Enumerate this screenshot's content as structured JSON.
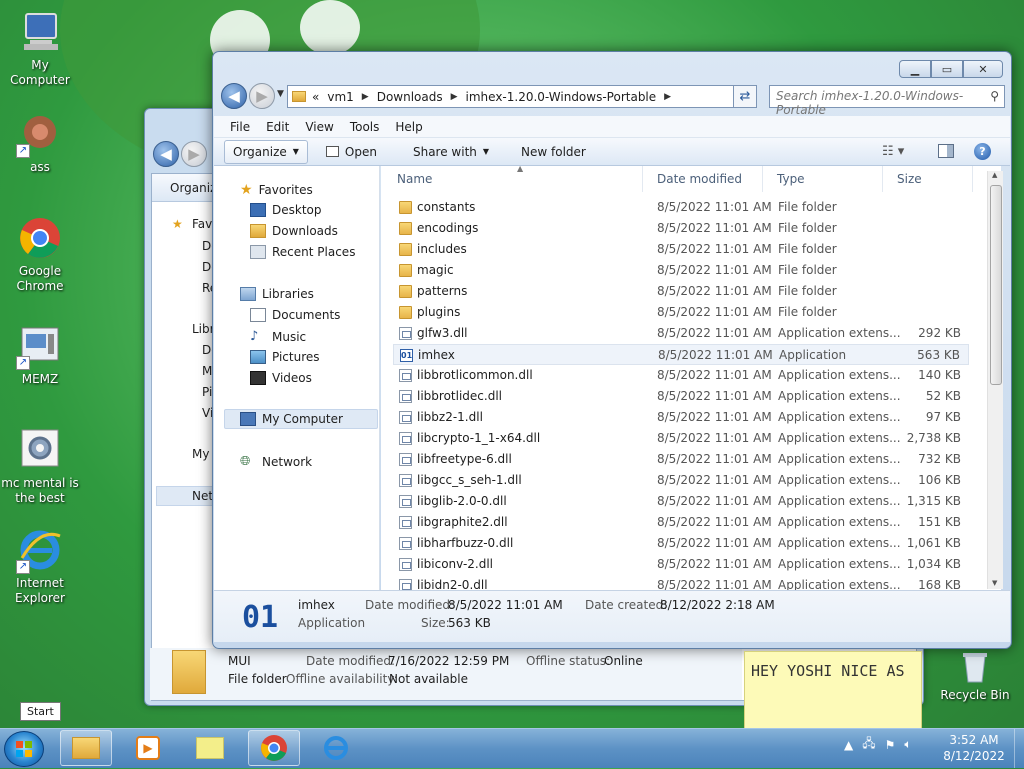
{
  "desktop": {
    "icons": [
      {
        "label": "My Computer"
      },
      {
        "label": "ass"
      },
      {
        "label": "Google Chrome"
      },
      {
        "label": "MEMZ"
      },
      {
        "label": "mc mental is the best"
      },
      {
        "label": "Internet Explorer"
      },
      {
        "label": "Recycle Bin"
      }
    ]
  },
  "back_window": {
    "toolbar_label": "Organize",
    "nav": [
      "Favo",
      "De",
      "Do",
      "Re",
      "Libr",
      "Do",
      "M",
      "Pi",
      "Vi",
      "My",
      "Net"
    ],
    "details": {
      "name": "MUI",
      "type": "File folder",
      "date_modified_label": "Date modified:",
      "date_modified": "7/16/2022 12:59 PM",
      "offline_status_label": "Offline status:",
      "offline_status": "Online",
      "offline_avail_label": "Offline availability:",
      "offline_avail": "Not available"
    }
  },
  "window": {
    "address": {
      "prefix": "«",
      "crumbs": [
        "vm1",
        "Downloads",
        "imhex-1.20.0-Windows-Portable"
      ]
    },
    "search_placeholder": "Search imhex-1.20.0-Windows-Portable",
    "menu": [
      "File",
      "Edit",
      "View",
      "Tools",
      "Help"
    ],
    "toolbar": {
      "organize": "Organize",
      "open": "Open",
      "share_with": "Share with",
      "new_folder": "New folder"
    },
    "nav": {
      "favorites": "Favorites",
      "desktop": "Desktop",
      "downloads": "Downloads",
      "recent": "Recent Places",
      "libraries": "Libraries",
      "documents": "Documents",
      "music": "Music",
      "pictures": "Pictures",
      "videos": "Videos",
      "computer": "My Computer",
      "network": "Network"
    },
    "columns": {
      "name": "Name",
      "date": "Date modified",
      "type": "Type",
      "size": "Size"
    },
    "files": [
      {
        "name": "constants",
        "date": "8/5/2022 11:01 AM",
        "type": "File folder",
        "size": "",
        "kind": "folder"
      },
      {
        "name": "encodings",
        "date": "8/5/2022 11:01 AM",
        "type": "File folder",
        "size": "",
        "kind": "folder"
      },
      {
        "name": "includes",
        "date": "8/5/2022 11:01 AM",
        "type": "File folder",
        "size": "",
        "kind": "folder"
      },
      {
        "name": "magic",
        "date": "8/5/2022 11:01 AM",
        "type": "File folder",
        "size": "",
        "kind": "folder"
      },
      {
        "name": "patterns",
        "date": "8/5/2022 11:01 AM",
        "type": "File folder",
        "size": "",
        "kind": "folder"
      },
      {
        "name": "plugins",
        "date": "8/5/2022 11:01 AM",
        "type": "File folder",
        "size": "",
        "kind": "folder"
      },
      {
        "name": "glfw3.dll",
        "date": "8/5/2022 11:01 AM",
        "type": "Application extens...",
        "size": "292 KB",
        "kind": "dll"
      },
      {
        "name": "imhex",
        "date": "8/5/2022 11:01 AM",
        "type": "Application",
        "size": "563 KB",
        "kind": "app"
      },
      {
        "name": "libbrotlicommon.dll",
        "date": "8/5/2022 11:01 AM",
        "type": "Application extens...",
        "size": "140 KB",
        "kind": "dll"
      },
      {
        "name": "libbrotlidec.dll",
        "date": "8/5/2022 11:01 AM",
        "type": "Application extens...",
        "size": "52 KB",
        "kind": "dll"
      },
      {
        "name": "libbz2-1.dll",
        "date": "8/5/2022 11:01 AM",
        "type": "Application extens...",
        "size": "97 KB",
        "kind": "dll"
      },
      {
        "name": "libcrypto-1_1-x64.dll",
        "date": "8/5/2022 11:01 AM",
        "type": "Application extens...",
        "size": "2,738 KB",
        "kind": "dll"
      },
      {
        "name": "libfreetype-6.dll",
        "date": "8/5/2022 11:01 AM",
        "type": "Application extens...",
        "size": "732 KB",
        "kind": "dll"
      },
      {
        "name": "libgcc_s_seh-1.dll",
        "date": "8/5/2022 11:01 AM",
        "type": "Application extens...",
        "size": "106 KB",
        "kind": "dll"
      },
      {
        "name": "libglib-2.0-0.dll",
        "date": "8/5/2022 11:01 AM",
        "type": "Application extens...",
        "size": "1,315 KB",
        "kind": "dll"
      },
      {
        "name": "libgraphite2.dll",
        "date": "8/5/2022 11:01 AM",
        "type": "Application extens...",
        "size": "151 KB",
        "kind": "dll"
      },
      {
        "name": "libharfbuzz-0.dll",
        "date": "8/5/2022 11:01 AM",
        "type": "Application extens...",
        "size": "1,061 KB",
        "kind": "dll"
      },
      {
        "name": "libiconv-2.dll",
        "date": "8/5/2022 11:01 AM",
        "type": "Application extens...",
        "size": "1,034 KB",
        "kind": "dll"
      },
      {
        "name": "libidn2-0.dll",
        "date": "8/5/2022 11:01 AM",
        "type": "Application extens...",
        "size": "168 KB",
        "kind": "dll"
      }
    ],
    "details": {
      "name": "imhex",
      "type": "Application",
      "date_modified_label": "Date modified:",
      "date_modified": "8/5/2022 11:01 AM",
      "date_created_label": "Date created:",
      "date_created": "8/12/2022 2:18 AM",
      "size_label": "Size:",
      "size": "563 KB"
    }
  },
  "sticky_note": {
    "text": "HEY YOSHI NICE AS"
  },
  "taskbar": {
    "start_tooltip": "Start",
    "time": "3:52 AM",
    "date": "8/12/2022"
  }
}
